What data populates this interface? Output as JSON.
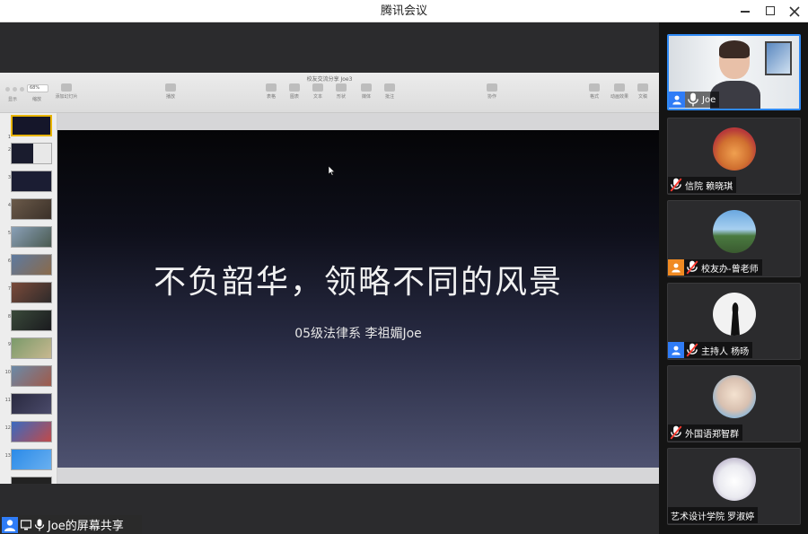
{
  "app": {
    "title": "腾讯会议",
    "window_controls": [
      "minimize",
      "maximize",
      "close"
    ]
  },
  "keynote": {
    "doc_title": "校友交流分享 Joe3",
    "zoom": "68%",
    "toolbar_left": [
      {
        "label": "显示",
        "icon": "view-icon"
      },
      {
        "label": "缩放",
        "icon": "zoom-icon"
      },
      {
        "label": "添加幻灯片",
        "icon": "add-slide-icon"
      }
    ],
    "toolbar_center": [
      {
        "label": "播放",
        "icon": "play-icon"
      }
    ],
    "toolbar_insert": [
      {
        "label": "表格",
        "icon": "table-icon"
      },
      {
        "label": "图表",
        "icon": "chart-icon"
      },
      {
        "label": "文本",
        "icon": "text-icon"
      },
      {
        "label": "形状",
        "icon": "shape-icon"
      },
      {
        "label": "媒体",
        "icon": "media-icon"
      },
      {
        "label": "批注",
        "icon": "comment-icon"
      }
    ],
    "toolbar_share": {
      "label": "协作",
      "icon": "collaborate-icon"
    },
    "toolbar_right": [
      {
        "label": "格式",
        "icon": "format-icon"
      },
      {
        "label": "动画效果",
        "icon": "animate-icon"
      },
      {
        "label": "文稿",
        "icon": "document-icon"
      }
    ],
    "slide_numbers": [
      "1",
      "2",
      "3",
      "4",
      "5",
      "6",
      "7",
      "8",
      "9",
      "10",
      "11",
      "12",
      "13"
    ],
    "slide": {
      "title": "不负韶华，领略不同的风景",
      "subtitle": "05级法律系  李祖媚Joe"
    }
  },
  "share_tag": {
    "label": "Joe的屏幕共享"
  },
  "participants": [
    {
      "name": "Joe",
      "muted": false,
      "has_video": true,
      "avatar_color": "#2f7cf6"
    },
    {
      "name": "信院 赖晓琪",
      "muted": true,
      "has_video": false,
      "avatar_color": ""
    },
    {
      "name": "校友办-曾老师",
      "muted": true,
      "has_video": false,
      "avatar_color": "#f08a22"
    },
    {
      "name": "主持人 杨旸",
      "muted": true,
      "has_video": false,
      "avatar_color": "#2f7cf6"
    },
    {
      "name": "外国语郑智群",
      "muted": true,
      "has_video": false,
      "avatar_color": ""
    },
    {
      "name": "艺术设计学院 罗淑婷",
      "muted": false,
      "has_video": false,
      "avatar_color": ""
    }
  ],
  "colors": {
    "accent": "#2f7cf6",
    "host_orange": "#f08a22",
    "active_speaker_border": "#2f8af5",
    "slide_highlight": "#e8b400"
  }
}
